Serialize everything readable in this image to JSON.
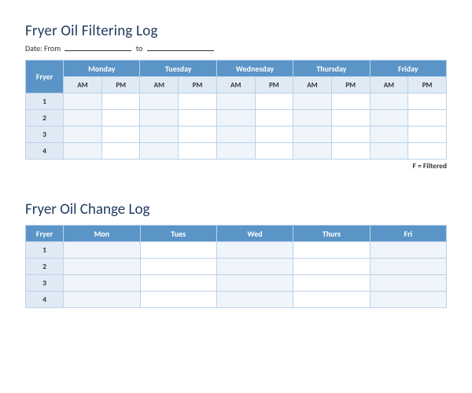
{
  "section1": {
    "title": "Fryer Oil Filtering Log",
    "date_prefix": "Date: From",
    "date_middle": "to",
    "headers": {
      "fryer": "Fryer",
      "days": [
        "Monday",
        "Tuesday",
        "Wednesday",
        "Thursday",
        "Friday"
      ],
      "am": "AM",
      "pm": "PM"
    },
    "rows": [
      "1",
      "2",
      "3",
      "4"
    ],
    "legend": "F = Filtered"
  },
  "section2": {
    "title": "Fryer Oil Change Log",
    "headers": {
      "fryer": "Fryer",
      "days": [
        "Mon",
        "Tues",
        "Wed",
        "Thurs",
        "Fri"
      ]
    },
    "rows": [
      "1",
      "2",
      "3",
      "4"
    ]
  }
}
